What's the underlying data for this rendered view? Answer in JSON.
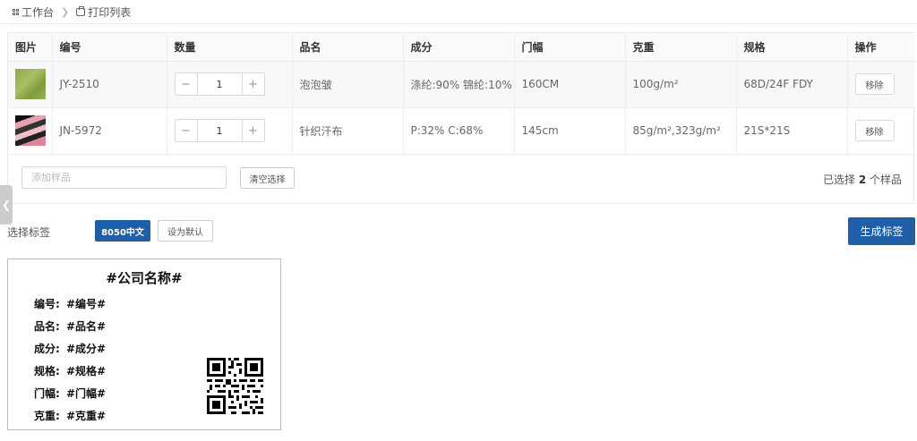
{
  "breadcrumb": {
    "home": "工作台",
    "current": "打印列表"
  },
  "table": {
    "headers": [
      "图片",
      "编号",
      "数量",
      "品名",
      "成分",
      "门幅",
      "克重",
      "规格",
      "操作"
    ],
    "rows": [
      {
        "code": "JY-2510",
        "qty": "1",
        "name": "泡泡皱",
        "composition": "涤纶:90% 锦纶:10%",
        "width": "160CM",
        "weight": "100g/m²",
        "spec": "68D/24F FDY",
        "action": "移除"
      },
      {
        "code": "JN-5972",
        "qty": "1",
        "name": "针织汗布",
        "composition": "P:32% C:68%",
        "width": "145cm",
        "weight": "85g/m²,323g/m²",
        "spec": "21S*21S",
        "action": "移除"
      }
    ]
  },
  "add_sample": {
    "placeholder": "添加样品",
    "clear_label": "清空选择",
    "selected_prefix": "已选择 ",
    "selected_count": "2",
    "selected_suffix": " 个样品"
  },
  "label_select": {
    "label": "选择标签",
    "tag_button": "8050中文",
    "default_button": "设为默认",
    "generate_button": "生成标签"
  },
  "label_card": {
    "title": "#公司名称#",
    "fields": [
      {
        "label": "编号:",
        "value": "#编号#"
      },
      {
        "label": "品名:",
        "value": "#品名#"
      },
      {
        "label": "成分:",
        "value": "#成分#"
      },
      {
        "label": "规格:",
        "value": "#规格#"
      },
      {
        "label": "门幅:",
        "value": "#门幅#"
      },
      {
        "label": "克重:",
        "value": "#克重#"
      }
    ]
  },
  "icons": {
    "home": "grid-icon",
    "print": "printer-icon",
    "sep": "chevron-right-icon",
    "side_tab": "chevron-left-icon",
    "qr": "qr-code-icon"
  },
  "colors": {
    "primary": "#1e5fa8"
  }
}
